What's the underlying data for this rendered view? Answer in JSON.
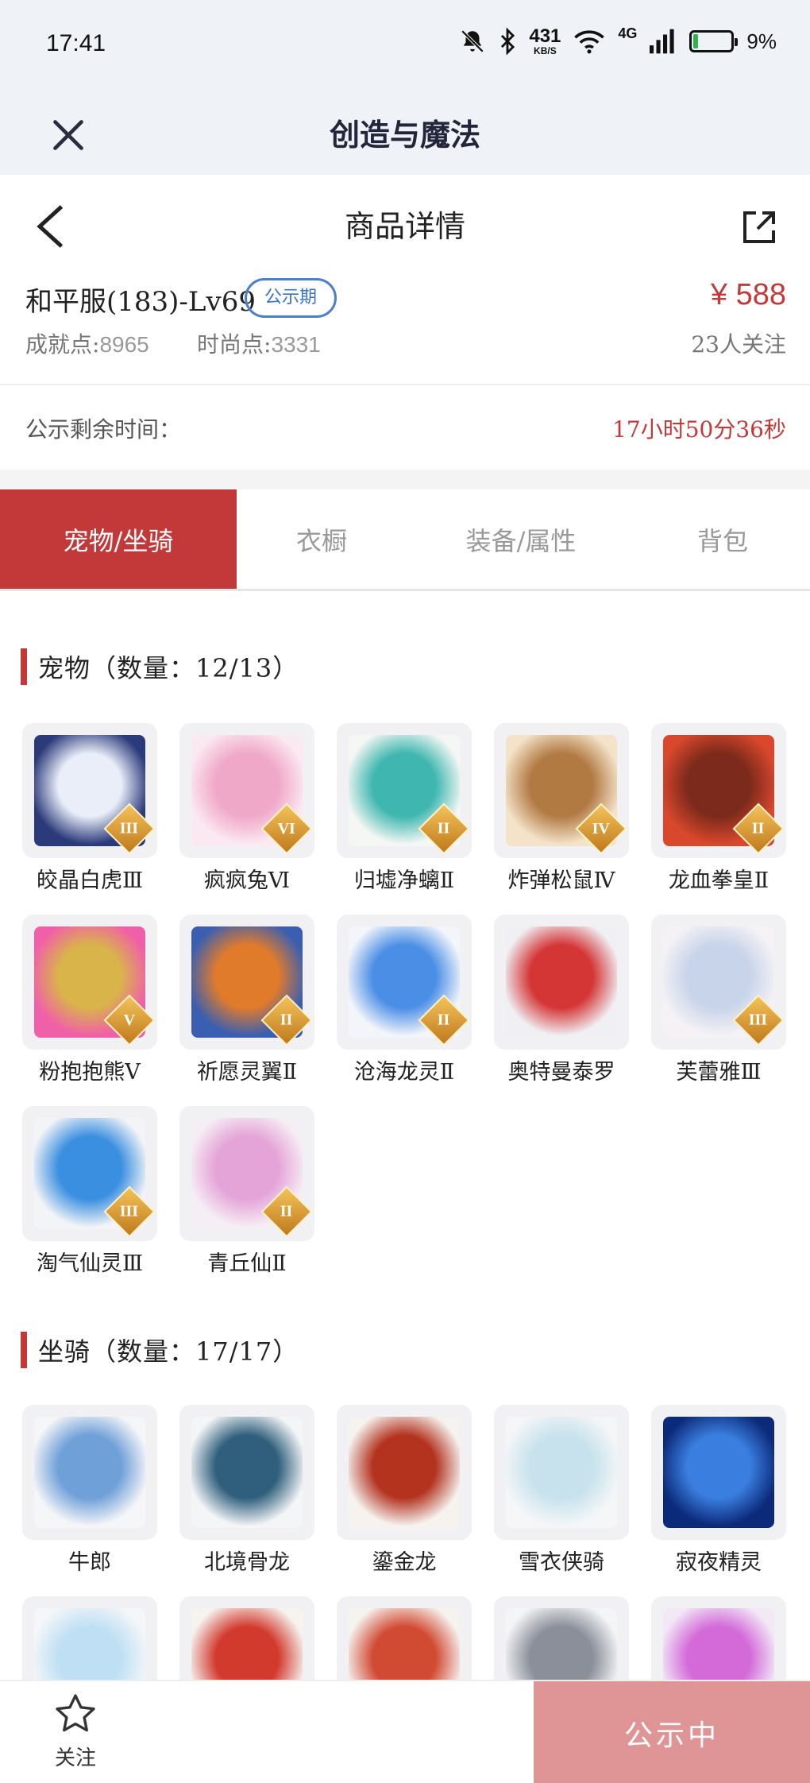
{
  "status_bar": {
    "time": "17:41",
    "net_speed": "431",
    "net_unit": "KB/S",
    "network": "4G",
    "battery": "9%"
  },
  "app": {
    "title": "创造与魔法"
  },
  "nav": {
    "title": "商品详情"
  },
  "product": {
    "name": "和平服(183)-Lv69",
    "badge": "公示期",
    "price": "¥ 588",
    "achievement_label": "成就点:",
    "achievement_value": "8965",
    "fashion_label": "时尚点:",
    "fashion_value": "3331",
    "followers": "23人关注"
  },
  "countdown": {
    "label": "公示剩余时间：",
    "value": "17小时50分36秒"
  },
  "tabs": [
    {
      "label": "宠物/坐骑",
      "active": true
    },
    {
      "label": "衣橱",
      "active": false
    },
    {
      "label": "装备/属性",
      "active": false
    },
    {
      "label": "背包",
      "active": false
    }
  ],
  "pets": {
    "title": "宠物（数量：12/13）",
    "items": [
      {
        "name": "皎晶白虎Ⅲ",
        "grade": "III",
        "icon": "white-tiger-icon",
        "colors": [
          "#2b3a7a",
          "#e9eef8"
        ]
      },
      {
        "name": "疯疯兔Ⅵ",
        "grade": "VI",
        "icon": "rabbit-icon",
        "colors": [
          "#fbe9f2",
          "#f0a8c8"
        ]
      },
      {
        "name": "归墟净螭Ⅱ",
        "grade": "II",
        "icon": "jade-dragon-icon",
        "colors": [
          "#f5f7f5",
          "#3fb7b0"
        ]
      },
      {
        "name": "炸弹松鼠Ⅳ",
        "grade": "IV",
        "icon": "squirrel-icon",
        "colors": [
          "#f4e3c9",
          "#b27a43"
        ]
      },
      {
        "name": "龙血拳皇Ⅱ",
        "grade": "II",
        "icon": "ram-beast-icon",
        "colors": [
          "#d9482c",
          "#7c2a1c"
        ]
      },
      {
        "name": "粉抱抱熊Ⅴ",
        "grade": "V",
        "icon": "pink-bear-icon",
        "colors": [
          "#f060a8",
          "#d9b44a"
        ]
      },
      {
        "name": "祈愿灵翼Ⅱ",
        "grade": "II",
        "icon": "phoenix-icon",
        "colors": [
          "#3b5fb0",
          "#e07b2c"
        ]
      },
      {
        "name": "沧海龙灵Ⅱ",
        "grade": "II",
        "icon": "sea-dragon-spirit-icon",
        "colors": [
          "#f2f5fa",
          "#4a8ee6"
        ]
      },
      {
        "name": "奥特曼泰罗",
        "grade": "",
        "icon": "ultraman-icon",
        "colors": [
          "#f0f0f4",
          "#d43535"
        ]
      },
      {
        "name": "芙蕾雅Ⅲ",
        "grade": "III",
        "icon": "valkyrie-icon",
        "colors": [
          "#f4f2f5",
          "#c8d4ea"
        ]
      },
      {
        "name": "淘气仙灵Ⅲ",
        "grade": "III",
        "icon": "blue-dog-icon",
        "colors": [
          "#f2f4f7",
          "#3a8fe0"
        ]
      },
      {
        "name": "青丘仙Ⅱ",
        "grade": "II",
        "icon": "fox-fairy-icon",
        "colors": [
          "#f6eef5",
          "#e4a4d8"
        ]
      }
    ]
  },
  "mounts": {
    "title": "坐骑（数量：17/17）",
    "items": [
      {
        "name": "牛郎",
        "grade": "",
        "icon": "ox-icon",
        "colors": [
          "#f5f6f8",
          "#6fa0d8"
        ]
      },
      {
        "name": "北境骨龙",
        "grade": "",
        "icon": "bone-dragon-icon",
        "colors": [
          "#f3f5f7",
          "#2f5f7c"
        ]
      },
      {
        "name": "鎏金龙",
        "grade": "",
        "icon": "gold-dragon-icon",
        "colors": [
          "#f6f3ef",
          "#b3331f"
        ]
      },
      {
        "name": "雪衣侠骑",
        "grade": "",
        "icon": "white-horse-icon",
        "colors": [
          "#f4f6f8",
          "#c7e2ec"
        ]
      },
      {
        "name": "寂夜精灵",
        "grade": "",
        "icon": "night-spirit-icon",
        "colors": [
          "#0c2a7a",
          "#3a7fe0"
        ]
      },
      {
        "name": "",
        "grade": "",
        "icon": "cloud-icon",
        "colors": [
          "#f4f6f8",
          "#bfe0f4"
        ]
      },
      {
        "name": "",
        "grade": "",
        "icon": "cake-icon",
        "colors": [
          "#f6f2ee",
          "#d23a2e"
        ]
      },
      {
        "name": "",
        "grade": "",
        "icon": "board-icon",
        "colors": [
          "#f6f2ee",
          "#d14a32"
        ]
      },
      {
        "name": "",
        "grade": "",
        "icon": "mech-wolf-icon",
        "colors": [
          "#f4f5f7",
          "#8a8f99"
        ]
      },
      {
        "name": "",
        "grade": "",
        "icon": "magic-orb-icon",
        "colors": [
          "#f2e8f6",
          "#d36ad8"
        ]
      }
    ]
  },
  "bottom": {
    "follow_label": "关注",
    "status_label": "公示中"
  },
  "colors": {
    "accent": "#c3393a",
    "badge_blue": "#3b73c4",
    "status_button": "#df9595"
  }
}
